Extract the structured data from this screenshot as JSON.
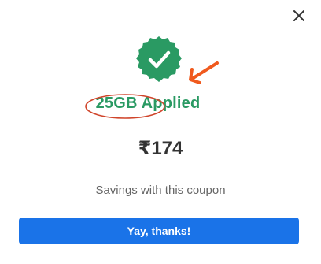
{
  "dialog": {
    "close_icon": "close-icon",
    "success_icon": "check-badge-icon",
    "title": "25GB Applied",
    "amount": "₹174",
    "savings_text": "Savings with this coupon",
    "cta_label": "Yay, thanks!"
  },
  "annotations": {
    "arrow_icon": "arrow-annotation-icon",
    "highlight_shape": "ellipse-annotation"
  },
  "colors": {
    "success_green": "#2a9a63",
    "primary_blue": "#1a73e8",
    "annotation_red": "#d0452b",
    "arrow_orange": "#f05a1e"
  }
}
